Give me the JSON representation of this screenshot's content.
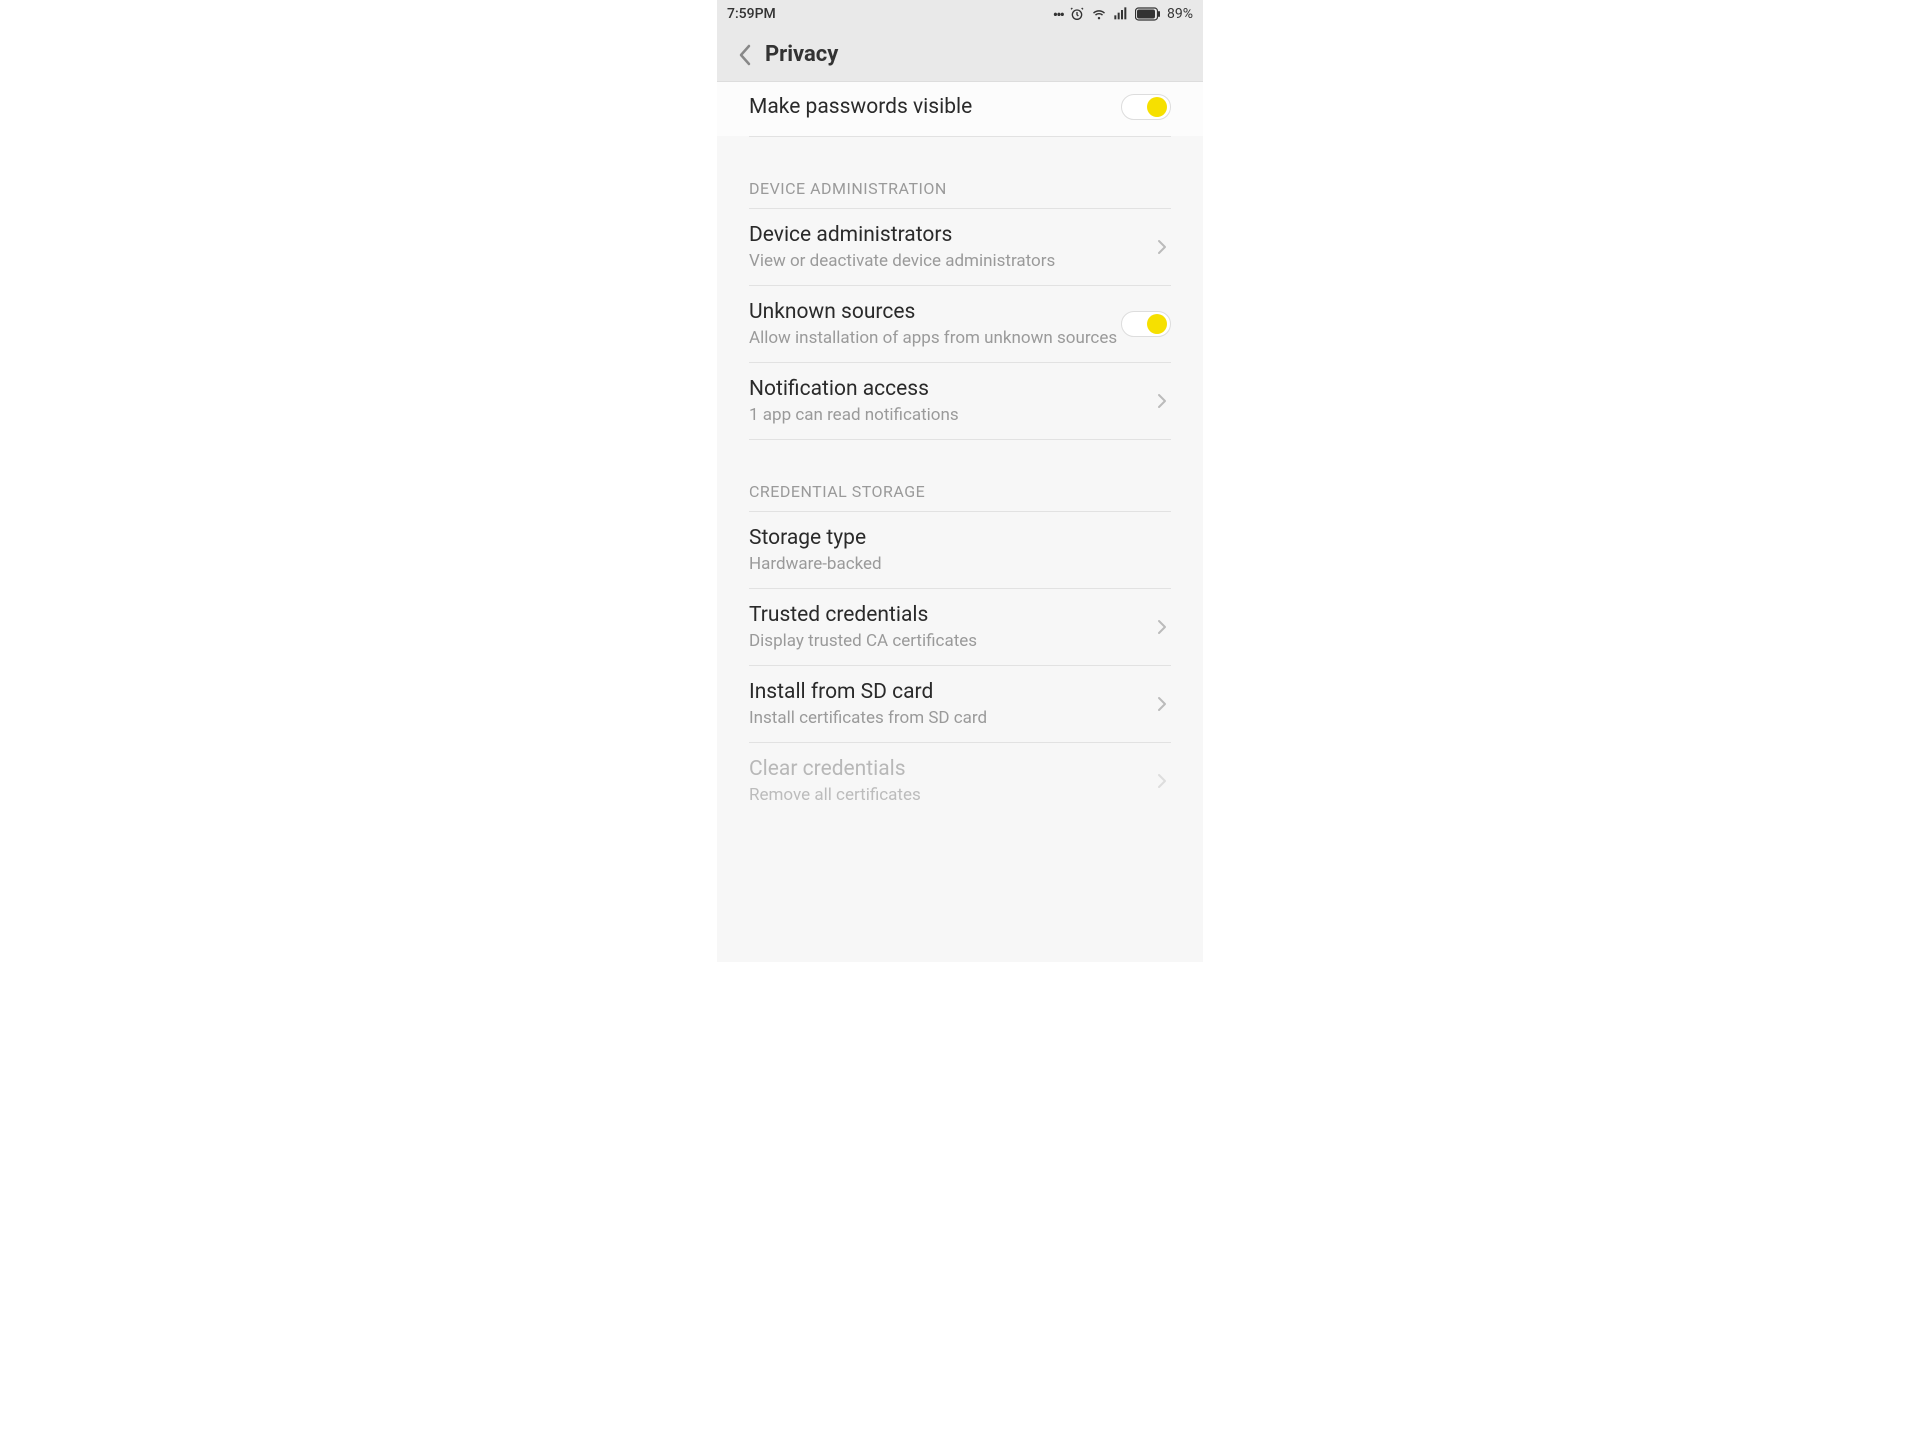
{
  "statusbar": {
    "time": "7:59PM",
    "battery_pct": "89%"
  },
  "header": {
    "title": "Privacy"
  },
  "rows": {
    "make_passwords_visible": {
      "title": "Make passwords visible"
    },
    "device_admin_section": "DEVICE ADMINISTRATION",
    "device_administrators": {
      "title": "Device administrators",
      "sub": "View or deactivate device administrators"
    },
    "unknown_sources": {
      "title": "Unknown sources",
      "sub": "Allow installation of apps from unknown sources"
    },
    "notification_access": {
      "title": "Notification access",
      "sub": "1 app can read notifications"
    },
    "credential_storage_section": "CREDENTIAL STORAGE",
    "storage_type": {
      "title": "Storage type",
      "sub": "Hardware-backed"
    },
    "trusted_credentials": {
      "title": "Trusted credentials",
      "sub": "Display trusted CA certificates"
    },
    "install_from_sd": {
      "title": "Install from SD card",
      "sub": "Install certificates from SD card"
    },
    "clear_credentials": {
      "title": "Clear credentials",
      "sub": "Remove all certificates"
    }
  }
}
